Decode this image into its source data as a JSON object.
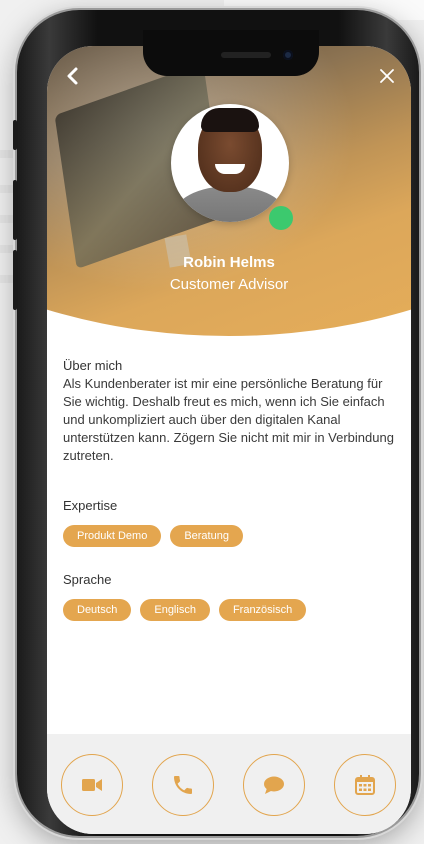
{
  "header": {
    "back_icon": "chevron-left-icon",
    "close_icon": "close-icon",
    "name": "Robin Helms",
    "role": "Customer Advisor",
    "status": "online"
  },
  "about": {
    "title": "Über mich",
    "text": "Als Kundenberater ist mir eine persönliche Beratung für Sie wichtig. Deshalb freut es mich, wenn ich Sie einfach und unkompliziert auch über den digitalen Kanal unterstützen kann. Zögern Sie nicht mit mir in Verbindung zutreten."
  },
  "expertise": {
    "title": "Expertise",
    "chips": [
      "Produkt Demo",
      "Beratung"
    ]
  },
  "language": {
    "title": "Sprache",
    "chips": [
      "Deutsch",
      "Englisch",
      "Französisch"
    ]
  },
  "actions": {
    "video_icon": "video-camera-icon",
    "phone_icon": "phone-icon",
    "chat_icon": "chat-bubble-icon",
    "calendar_icon": "calendar-icon"
  },
  "colors": {
    "accent": "#e4a64f",
    "status_online": "#3cc96e",
    "footer_bg": "#f0f0f0"
  }
}
